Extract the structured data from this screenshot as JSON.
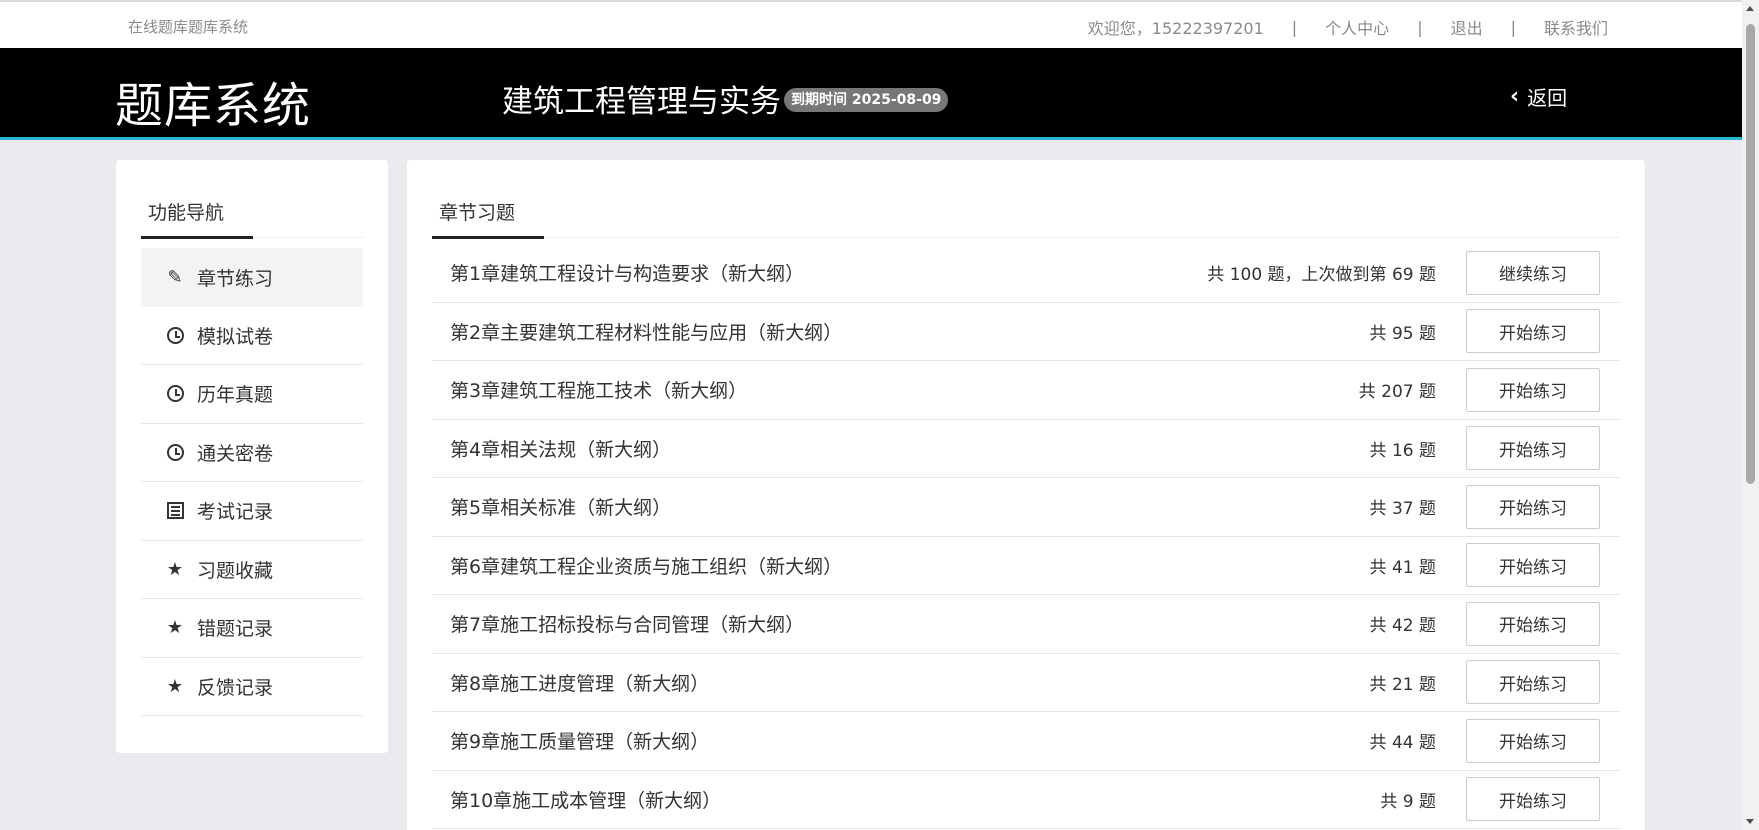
{
  "topbar": {
    "site_name": "在线题库题库系统",
    "welcome": "欢迎您，15222397201",
    "sep": "|",
    "links": [
      "个人中心",
      "退出",
      "联系我们"
    ]
  },
  "header": {
    "logo": "题库系统",
    "course": "建筑工程管理与实务",
    "expiry": "到期时间 2025-08-09",
    "back": "返回"
  },
  "sidebar": {
    "title": "功能导航",
    "items": [
      {
        "label": "章节练习",
        "icon": "pencil-icon",
        "active": true
      },
      {
        "label": "模拟试卷",
        "icon": "clock-icon"
      },
      {
        "label": "历年真题",
        "icon": "clock-icon"
      },
      {
        "label": "通关密卷",
        "icon": "clock-icon"
      },
      {
        "label": "考试记录",
        "icon": "list-icon"
      },
      {
        "label": "习题收藏",
        "icon": "star-icon"
      },
      {
        "label": "错题记录",
        "icon": "star-icon"
      },
      {
        "label": "反馈记录",
        "icon": "star-icon"
      }
    ]
  },
  "main": {
    "title": "章节习题",
    "chapters": [
      {
        "name": "第1章建筑工程设计与构造要求（新大纲）",
        "count": "共 100 题，上次做到第 69 题",
        "button": "继续练习"
      },
      {
        "name": "第2章主要建筑工程材料性能与应用（新大纲）",
        "count": "共 95 题",
        "button": "开始练习"
      },
      {
        "name": "第3章建筑工程施工技术（新大纲）",
        "count": "共 207 题",
        "button": "开始练习"
      },
      {
        "name": "第4章相关法规（新大纲）",
        "count": "共 16 题",
        "button": "开始练习"
      },
      {
        "name": "第5章相关标准（新大纲）",
        "count": "共 37 题",
        "button": "开始练习"
      },
      {
        "name": "第6章建筑工程企业资质与施工组织（新大纲）",
        "count": "共 41 题",
        "button": "开始练习"
      },
      {
        "name": "第7章施工招标投标与合同管理（新大纲）",
        "count": "共 42 题",
        "button": "开始练习"
      },
      {
        "name": "第8章施工进度管理（新大纲）",
        "count": "共 21 题",
        "button": "开始练习"
      },
      {
        "name": "第9章施工质量管理（新大纲）",
        "count": "共 44 题",
        "button": "开始练习"
      },
      {
        "name": "第10章施工成本管理（新大纲）",
        "count": "共 9 题",
        "button": "开始练习"
      }
    ]
  },
  "colors": {
    "header_bg": "#000000",
    "header_accent": "#29b6d4",
    "page_bg": "#e9ebee",
    "expiry_badge": "#777777"
  }
}
